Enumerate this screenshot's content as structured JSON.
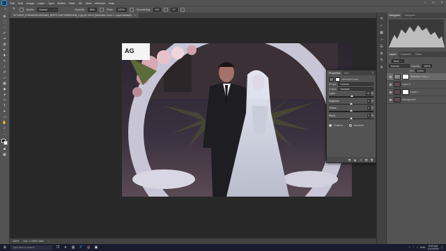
{
  "menubar": {
    "logo": "Ps",
    "items": [
      "File",
      "Edit",
      "Image",
      "Layer",
      "Type",
      "Select",
      "Filter",
      "3D",
      "View",
      "Window",
      "Help"
    ]
  },
  "options": {
    "mode_label": "Mode:",
    "mode_value": "Normal",
    "opacity_label": "Opacity:",
    "opacity_value": "86%",
    "flow_label": "Flow:",
    "flow_value": "100%",
    "smoothing_label": "Smoothing:",
    "smoothing_value": "0%",
    "angle_value": "0°"
  },
  "document": {
    "tab_title": "78712640_97584822513941981_8257271607499820448_n.jpg @ 100% (Selective Color 1, Layer Mask/8)"
  },
  "status": {
    "zoom": "100%",
    "doc_size": "Doc: 1.70M/7.46M"
  },
  "canvas": {
    "watermark": "AG"
  },
  "panels": {
    "top_tabs": [
      "Histogram",
      "Navigator"
    ],
    "layer_tabs": [
      "Layers",
      "Channels",
      "Paths"
    ],
    "kind_label": "Kind",
    "blend_mode": "Normal",
    "opacity_label": "Opacity:",
    "opacity_value": "100%",
    "fill_label": "Fill:",
    "fill_value": "100%",
    "layers": [
      {
        "name": "Selective Color 1",
        "selected": true,
        "has_mask": true
      },
      {
        "name": "Layer 2",
        "selected": false,
        "has_mask": false
      },
      {
        "name": "Layer 1",
        "selected": false,
        "has_mask": true
      },
      {
        "name": "Background",
        "selected": false,
        "has_mask": false
      }
    ]
  },
  "properties": {
    "tabs": [
      "Properties",
      "Info"
    ],
    "title": "Selective Color",
    "preset_label": "Preset:",
    "preset_value": "Custom",
    "colors_label": "Colors:",
    "colors_value": "Neutrals",
    "sliders": [
      {
        "label": "Cyan:",
        "value": "+5",
        "unit": "%",
        "level": 0.52
      },
      {
        "label": "Magenta:",
        "value": "0",
        "unit": "%",
        "level": 0.5
      },
      {
        "label": "Yellow:",
        "value": "0",
        "unit": "%",
        "level": 0.5
      },
      {
        "label": "Black:",
        "value": "0",
        "unit": "%",
        "level": 0.5
      }
    ],
    "method_relative": "Relative",
    "method_absolute": "Absolute"
  },
  "taskbar": {
    "search_placeholder": "Type here to search",
    "time": "8:03 AM",
    "date": "1/10/2020",
    "lang": "ENG"
  }
}
